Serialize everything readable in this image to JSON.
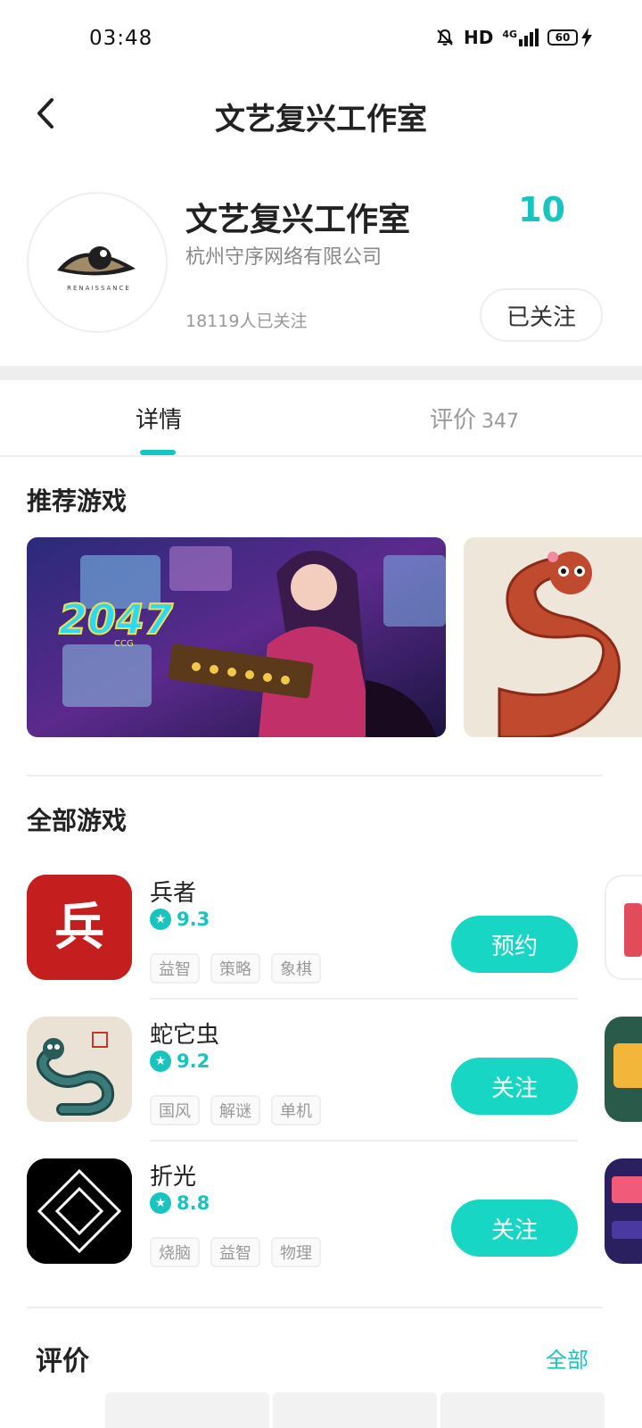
{
  "status_bar": {
    "time": "03:48",
    "network": "HD",
    "signal": "4G",
    "battery": "60"
  },
  "header": {
    "title": "文艺复兴工作室"
  },
  "studio": {
    "name": "文艺复兴工作室",
    "company": "杭州守序网络有限公司",
    "followers": "18119人已关注",
    "count": "10",
    "follow_button": "已关注",
    "logo_text": "RENAISSANCE"
  },
  "tabs": [
    {
      "label": "详情",
      "active": true
    },
    {
      "label": "评价",
      "count": "347",
      "active": false
    }
  ],
  "recommended": {
    "title": "推荐游戏",
    "banner_logo_text": "2047",
    "banner_logo_sub": "CCG"
  },
  "all_games": {
    "title": "全部游戏",
    "items": [
      {
        "name": "兵者",
        "rating": "9.3",
        "tags": [
          "益智",
          "策略",
          "象棋"
        ],
        "action": "预约",
        "icon_char": "兵"
      },
      {
        "name": "蛇它虫",
        "rating": "9.2",
        "tags": [
          "国风",
          "解谜",
          "单机"
        ],
        "action": "关注"
      },
      {
        "name": "折光",
        "rating": "8.8",
        "tags": [
          "烧脑",
          "益智",
          "物理"
        ],
        "action": "关注"
      }
    ]
  },
  "reviews": {
    "title": "评价",
    "all_label": "全部"
  },
  "colors": {
    "accent": "#18c4bf",
    "button": "#18d6c4"
  }
}
